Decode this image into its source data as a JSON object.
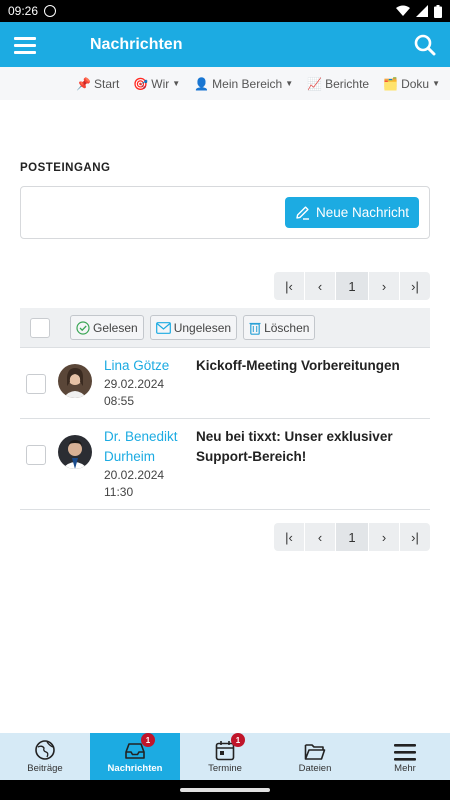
{
  "status_bar": {
    "time": "09:26"
  },
  "app_bar": {
    "title": "Nachrichten"
  },
  "top_nav": {
    "items": [
      {
        "emoji": "📌",
        "label": "Start",
        "dropdown": false
      },
      {
        "emoji": "🎯",
        "label": "Wir",
        "dropdown": true
      },
      {
        "emoji": "👤",
        "label": "Mein Bereich",
        "dropdown": true
      },
      {
        "emoji": "📈",
        "label": "Berichte",
        "dropdown": false
      },
      {
        "emoji": "🗂️",
        "label": "Doku",
        "dropdown": true
      }
    ]
  },
  "inbox": {
    "title": "POSTEINGANG",
    "new_message_label": "Neue Nachricht",
    "page": "1",
    "toolbar": {
      "read_label": "Gelesen",
      "unread_label": "Ungelesen",
      "delete_label": "Löschen"
    },
    "messages": [
      {
        "sender": "Lina Götze",
        "date": "29.02.2024",
        "time": "08:55",
        "subject": "Kickoff-Meeting Vorbereitungen"
      },
      {
        "sender": "Dr. Benedikt Durheim",
        "date": "20.02.2024",
        "time": "11:30",
        "subject": "Neu bei tixxt: Unser exklusiver Support-Bereich!"
      }
    ]
  },
  "bottom_nav": {
    "items": [
      {
        "label": "Beiträge",
        "icon": "globe-icon",
        "badge": ""
      },
      {
        "label": "Nachrichten",
        "icon": "inbox-icon",
        "badge": "1",
        "active": true
      },
      {
        "label": "Termine",
        "icon": "calendar-icon",
        "badge": "1"
      },
      {
        "label": "Dateien",
        "icon": "folder-icon",
        "badge": ""
      },
      {
        "label": "Mehr",
        "icon": "menu-icon",
        "badge": ""
      }
    ]
  },
  "colors": {
    "accent": "#1cabe2",
    "badge": "#c0152a",
    "bottom_nav_bg": "#d6eaf6"
  }
}
